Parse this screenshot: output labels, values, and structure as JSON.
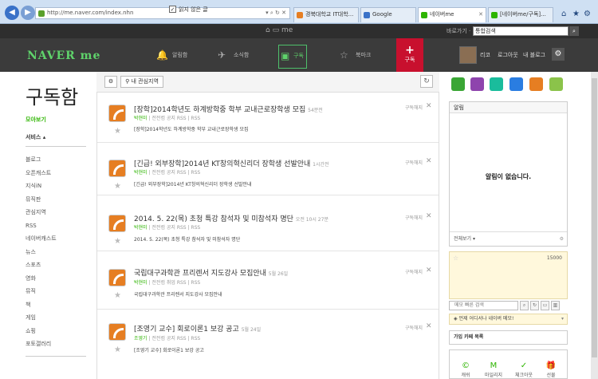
{
  "browser": {
    "url": "http://me.naver.com/index.nhn",
    "url_controls": "▾ ⌕ ↻ ✕",
    "tabs": [
      "경북대학교 IT대학...",
      "Google",
      "네이버me",
      "[네이버me/구독]..."
    ],
    "window_controls": [
      "⌂",
      "★",
      "⚙"
    ]
  },
  "topbar": {
    "center_glyphs": "⌂  ▭  me",
    "link": "바로가기 ·",
    "search_value": "통합검색",
    "search_button": "⌕"
  },
  "header": {
    "logo": "NAVER me",
    "menu": [
      {
        "label": "알림함",
        "icon": "bell-icon",
        "glyph": "🔔"
      },
      {
        "label": "소식함",
        "icon": "send-icon",
        "glyph": "✈"
      },
      {
        "label": "구독함",
        "icon": "subscribe-icon",
        "glyph": "▣"
      },
      {
        "label": "북마크",
        "icon": "bookmark-icon",
        "glyph": "☆"
      }
    ],
    "subscribe_button": {
      "plus": "+",
      "label": "구독"
    },
    "user_name": "리코",
    "logout": "로그아웃",
    "my_blog": "내 블로그",
    "settings": "⚙"
  },
  "left": {
    "title": "구독함",
    "view_all": "모아보기",
    "services": "서비스 ▴",
    "items": [
      "블로그",
      "오픈캐스트",
      "지식iN",
      "뮤직판",
      "관심지역",
      "RSS",
      "네이버캐스트",
      "뉴스",
      "스포츠",
      "영화",
      "뮤직",
      "책",
      "게임",
      "쇼핑",
      "포토갤러리"
    ]
  },
  "toolbar": {
    "settings": "⚙",
    "interest_region": "⚲ 내 관심지역",
    "check": "✓",
    "unread_only": "읽지 않은 글",
    "refresh": "↻"
  },
  "feeds": [
    {
      "title": "[장학]2014학년도 하계방학중 학부 교내근로장학생 모집",
      "meta": "54분전",
      "author": "박현미",
      "source": " | 전전컴 공지 RSS | RSS",
      "summary": "[장학]2014학년도 하계방학중 학부 교내근로장학생 모집",
      "unsub": "구독해지",
      "close": "✕",
      "star": "★"
    },
    {
      "title": "[긴급! 외부장학]2014년 KT창의혁신리더 장학생 선발안내",
      "meta": "1시간전",
      "author": "박현미",
      "source": " | 전전컴 공지 RSS | RSS",
      "summary": "[긴급! 외부장학]2014년 KT창의혁신리더 장학생 선발안내",
      "unsub": "구독해지",
      "close": "✕",
      "star": "★"
    },
    {
      "title": "2014. 5. 22(목) 초청 특강 참석자 및 미참석자 명단",
      "meta": "오전 10시 27분",
      "author": "박현미",
      "source": " | 전전컴 공지 RSS | RSS",
      "summary": "2014. 5. 22(목) 초청 특강 참석자 및 미참석자 명단",
      "unsub": "구독해지",
      "close": "✕",
      "star": "★"
    },
    {
      "title": "국립대구과학관 프리렌서 지도강사 모집안내",
      "meta": "5월 26일",
      "author": "박현미",
      "source": " | 전전컴 취업 RSS | RSS",
      "summary": "국립대구과학관 프리렌서 지도강사 모집안내",
      "unsub": "구독해지",
      "close": "✕",
      "star": "★"
    },
    {
      "title": "[조영기 교수] 회로이론1 보강 공고",
      "meta": "5월 24일",
      "author": "조영기",
      "source": " | 전전컴 공지 RSS | RSS",
      "summary": "[조영기 교수] 회로이론1 보강 공고",
      "unsub": "구독해지",
      "close": "✕",
      "star": "★"
    }
  ],
  "apps": [
    {
      "name": "mail-app-icon",
      "color": "#3aa635"
    },
    {
      "name": "calendar-app-icon",
      "color": "#8e44ad"
    },
    {
      "name": "contacts-app-icon",
      "color": "#1abc9c"
    },
    {
      "name": "ndrive-app-icon",
      "color": "#2a7de1"
    },
    {
      "name": "media-app-icon",
      "color": "#e67e22"
    },
    {
      "name": "memo-app-icon",
      "color": "#8bc34a"
    }
  ],
  "notify": {
    "header": "알림",
    "empty": "알림이 없습니다.",
    "view_all": "전체보기 ▾",
    "gear": "⚙"
  },
  "memo": {
    "star": "☆",
    "count": "15000",
    "search_placeholder": "메모 빠른 검색",
    "buttons": [
      "⌕",
      "↻",
      "▭",
      "▥"
    ],
    "prompt": "◈ 언제 어디서나 네이버 메모!",
    "prompt_toggle": "▾"
  },
  "club": {
    "label": "가입 카페 목록"
  },
  "bottom_icons": [
    {
      "glyph": "©",
      "label": "캐쉬"
    },
    {
      "glyph": "M",
      "label": "마일리지"
    },
    {
      "glyph": "✓",
      "label": "체크아웃"
    },
    {
      "glyph": "🎁",
      "label": "선물"
    }
  ]
}
